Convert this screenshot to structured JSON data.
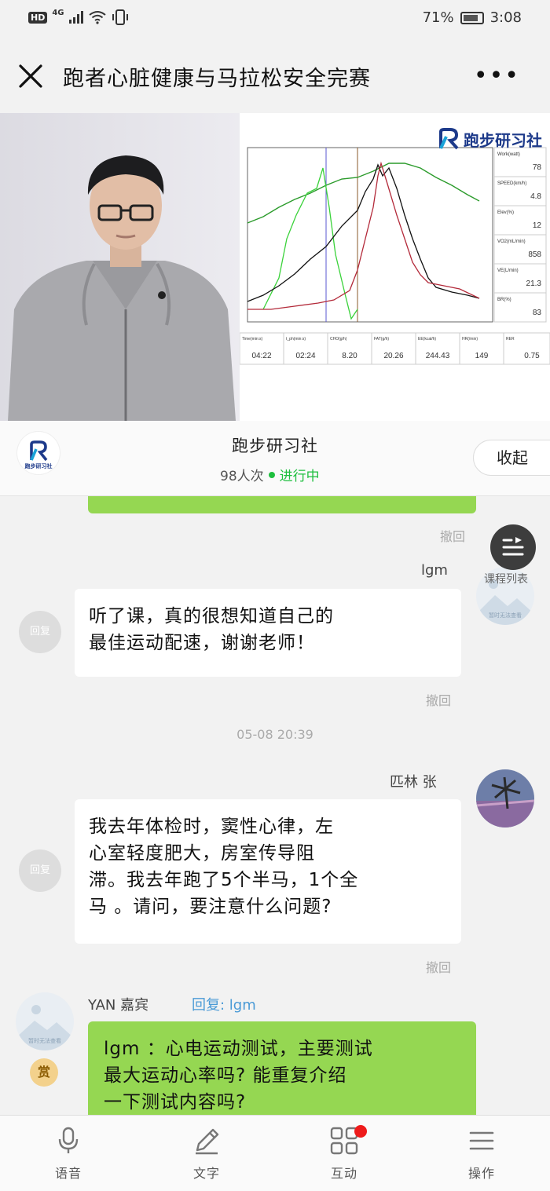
{
  "status_bar": {
    "hd": "HD",
    "network": "4G",
    "battery": "71%",
    "time": "3:08"
  },
  "header": {
    "title": "跑者心脏健康与马拉松安全完赛",
    "more": "•••"
  },
  "slide": {
    "brand": "跑步研习社",
    "right_panel": [
      {
        "label": "Work(watt)",
        "value": "78"
      },
      {
        "label": "SPEED(km/h)",
        "value": "4.8"
      },
      {
        "label": "Elev(%)",
        "value": "12"
      },
      {
        "label": "VO2(mL/min)",
        "value": "858"
      },
      {
        "label": "VE(L/min)",
        "value": "21.3"
      },
      {
        "label": "BR(%)",
        "value": "83"
      }
    ],
    "bottom_panel": [
      {
        "label": "Time(min:s)",
        "value": "04:22"
      },
      {
        "label": "t_ph(min:s)",
        "value": "02:24"
      },
      {
        "label": "CHO(g/h)",
        "value": "8.20"
      },
      {
        "label": "FAT(g/h)",
        "value": "20.26"
      },
      {
        "label": "EE(kcal/h)",
        "value": "244.43"
      },
      {
        "label": "HR(/min)",
        "value": "149"
      },
      {
        "label": "RER",
        "value": "0.75"
      }
    ]
  },
  "live": {
    "channel": "跑步研习社",
    "views": "98人次",
    "status": "进行中",
    "collapse": "收起",
    "logo_text": "跑步研习社"
  },
  "course_list": {
    "label": "课程列表"
  },
  "chat": {
    "recall_1": "撤回",
    "msg1": {
      "nick": "lgm",
      "reply": "回复",
      "text_line1": "听了课，真的很想知道自己的",
      "text_line2": "最佳运动配速，谢谢老师！",
      "recall": "撤回",
      "avatar_caption": "暂时无法查看"
    },
    "timestamp": "05-08 20:39",
    "msg2": {
      "nick": "匹林 张",
      "reply": "回复",
      "text_line1": "我去年体检时，窦性心律，左",
      "text_line2": "心室轻度肥大，房室传导阻",
      "text_line3": "滞。我去年跑了5个半马，1个全",
      "text_line4": "马 。请问，要注意什么问题?",
      "recall": "撤回"
    },
    "msg3": {
      "nick": "YAN 嘉宾",
      "reply_to": "回复: lgm",
      "tip": "赏",
      "avatar_caption": "暂时无法查看",
      "text_line1": "lgm ：心电运动测试，主要测试",
      "text_line2": "最大运动心率吗? 能重复介绍",
      "text_line3": "一下测试内容吗?"
    }
  },
  "tabs": {
    "voice": "语音",
    "text": "文字",
    "interact": "互动",
    "action": "操作"
  }
}
